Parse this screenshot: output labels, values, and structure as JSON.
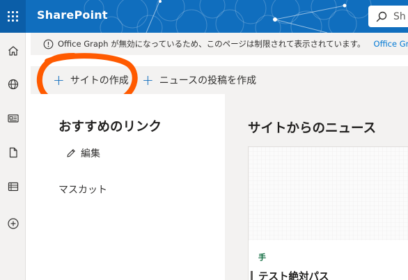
{
  "suite": {
    "app_name": "SharePoint",
    "search_placeholder": "Sh",
    "brand_color": "#106ebe"
  },
  "rail": {
    "items": [
      {
        "icon": "home-icon"
      },
      {
        "icon": "globe-icon"
      },
      {
        "icon": "news-icon"
      },
      {
        "icon": "document-icon"
      },
      {
        "icon": "list-icon"
      },
      {
        "icon": "add-circle-icon"
      }
    ]
  },
  "banner": {
    "icon": "info-icon",
    "text": "Office Graph が無効になっているため、このページは制限されて表示されています。",
    "link": "Office Gr"
  },
  "commands": {
    "create_site": "サイトの作成",
    "create_news": "ニュースの投稿を作成",
    "highlight_color": "#ff5a00"
  },
  "links": {
    "title": "おすすめのリンク",
    "edit_label": "編集",
    "items": [
      "マスカット"
    ]
  },
  "news": {
    "title": "サイトからのニュース",
    "card": {
      "tag": "手",
      "headline": "テスト絶対パス"
    }
  }
}
